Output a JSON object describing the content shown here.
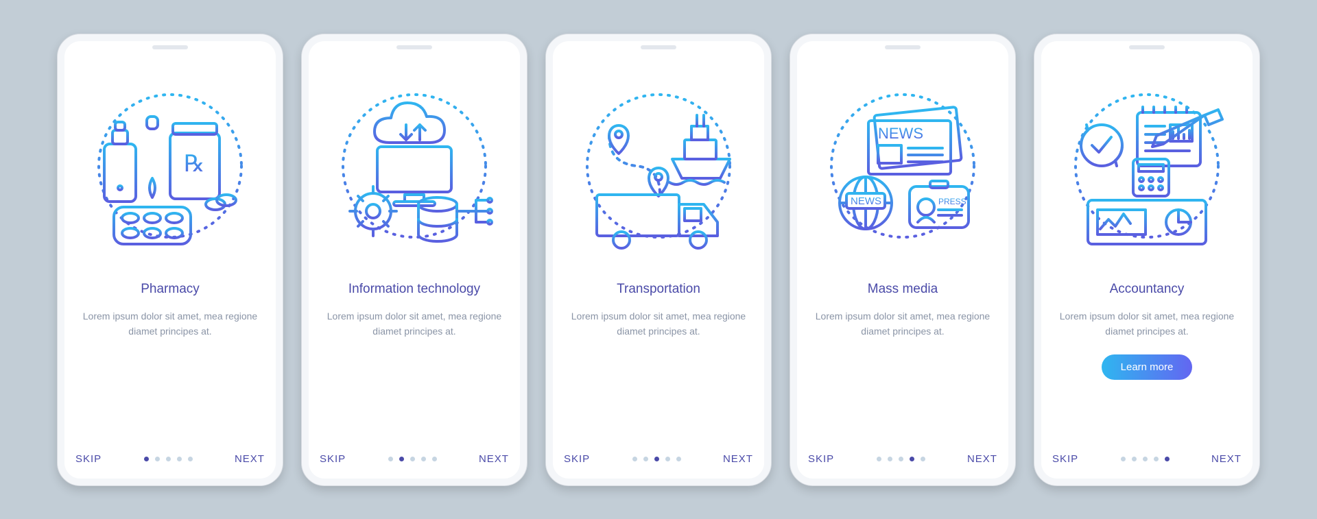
{
  "common": {
    "skip_label": "SKIP",
    "next_label": "NEXT",
    "learn_more_label": "Learn more",
    "description": "Lorem ipsum dolor sit amet, mea regione diamet principes at.",
    "dot_count": 5
  },
  "screens": [
    {
      "title": "Pharmacy",
      "icon": "pharmacy-icon",
      "active_dot": 0,
      "has_cta": false
    },
    {
      "title": "Information technology",
      "icon": "it-icon",
      "active_dot": 1,
      "has_cta": false
    },
    {
      "title": "Transportation",
      "icon": "transport-icon",
      "active_dot": 2,
      "has_cta": false
    },
    {
      "title": "Mass media",
      "icon": "media-icon",
      "active_dot": 3,
      "has_cta": false
    },
    {
      "title": "Accountancy",
      "icon": "accountancy-icon",
      "active_dot": 4,
      "has_cta": true
    }
  ],
  "colors": {
    "stroke_from": "#2fb6f0",
    "stroke_to": "#5a5fe0",
    "page_bg": "#c2cdd6"
  }
}
